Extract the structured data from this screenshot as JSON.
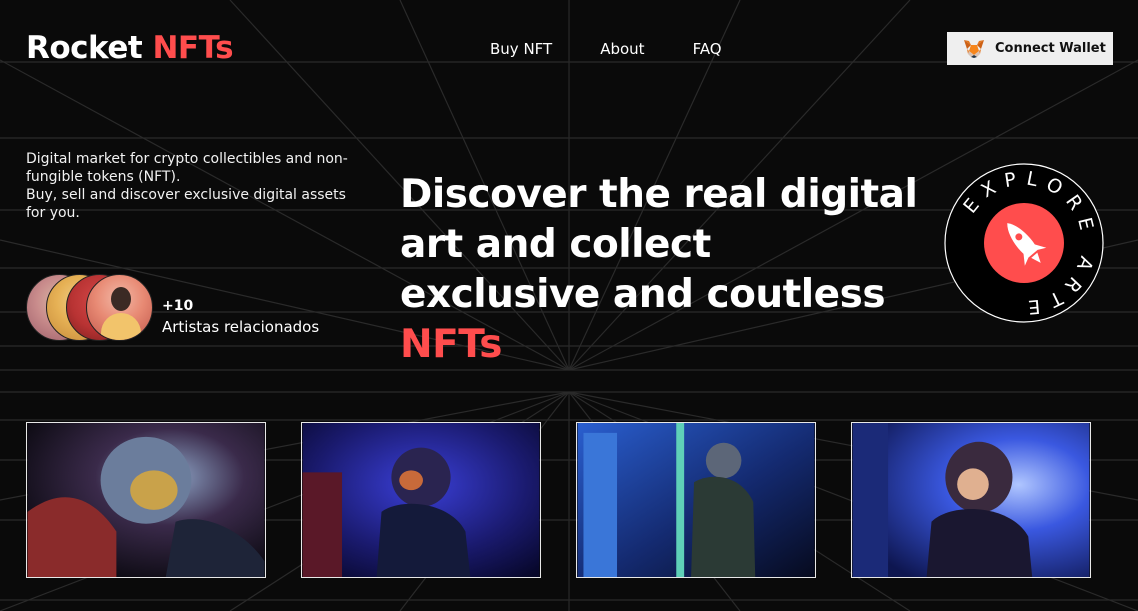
{
  "header": {
    "logo_text": "Rocket",
    "logo_accent": "NFTs",
    "nav": [
      "Buy NFT",
      "About",
      "FAQ"
    ],
    "wallet_button": "Connect Wallet",
    "wallet_icon": "metamask-fox-icon"
  },
  "intro": {
    "line1": "Digital market for crypto collectibles and non-fungible tokens (NFT).",
    "line2": "Buy, sell and discover exclusive digital assets for you."
  },
  "artists": {
    "count": "+10",
    "label": "Artistas relacionados"
  },
  "hero": {
    "title": "Discover the real digital art and collect exclusive and coutless",
    "title_accent": "NFTs"
  },
  "badge": {
    "text": "EXPLORE ARTE",
    "icon": "rocket-icon"
  },
  "gallery": [
    {
      "name": "astronaut-image-1"
    },
    {
      "name": "astronaut-image-2"
    },
    {
      "name": "astronaut-image-3"
    },
    {
      "name": "astronaut-image-4"
    }
  ],
  "colors": {
    "accent": "#ff4d4d",
    "background": "#0a0a0a",
    "wallet_bg": "#efefef"
  }
}
